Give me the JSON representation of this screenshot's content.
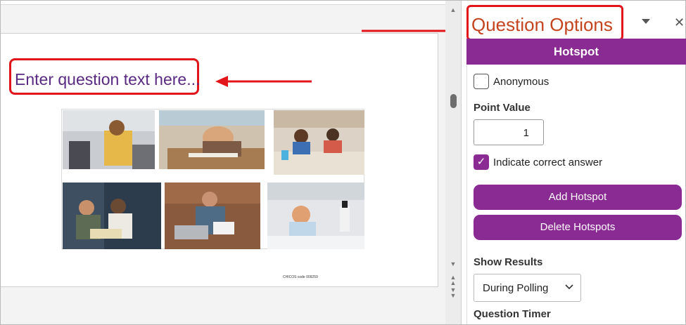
{
  "slide": {
    "question_placeholder": "Enter question text here...",
    "footer_text": "CHICOS code 009259"
  },
  "panel": {
    "title": "Question Options",
    "header": "Hotspot",
    "anonymous_label": "Anonymous",
    "point_value_label": "Point Value",
    "point_value": "1",
    "indicate_correct_label": "Indicate correct answer",
    "add_hotspot_label": "Add Hotspot",
    "delete_hotspots_label": "Delete Hotspots",
    "show_results_label": "Show Results",
    "show_results_value": "During Polling",
    "question_timer_label": "Question Timer",
    "anonymous_checked": false,
    "indicate_correct_checked": true
  },
  "colors": {
    "accent": "#8a2a93",
    "annotation_red": "#e2151b",
    "title_orange": "#c4441e",
    "question_text": "#5a2a82"
  },
  "icons": {
    "dropdown": "chevron-down-icon",
    "close": "close-icon",
    "checkmark": "check-icon"
  }
}
